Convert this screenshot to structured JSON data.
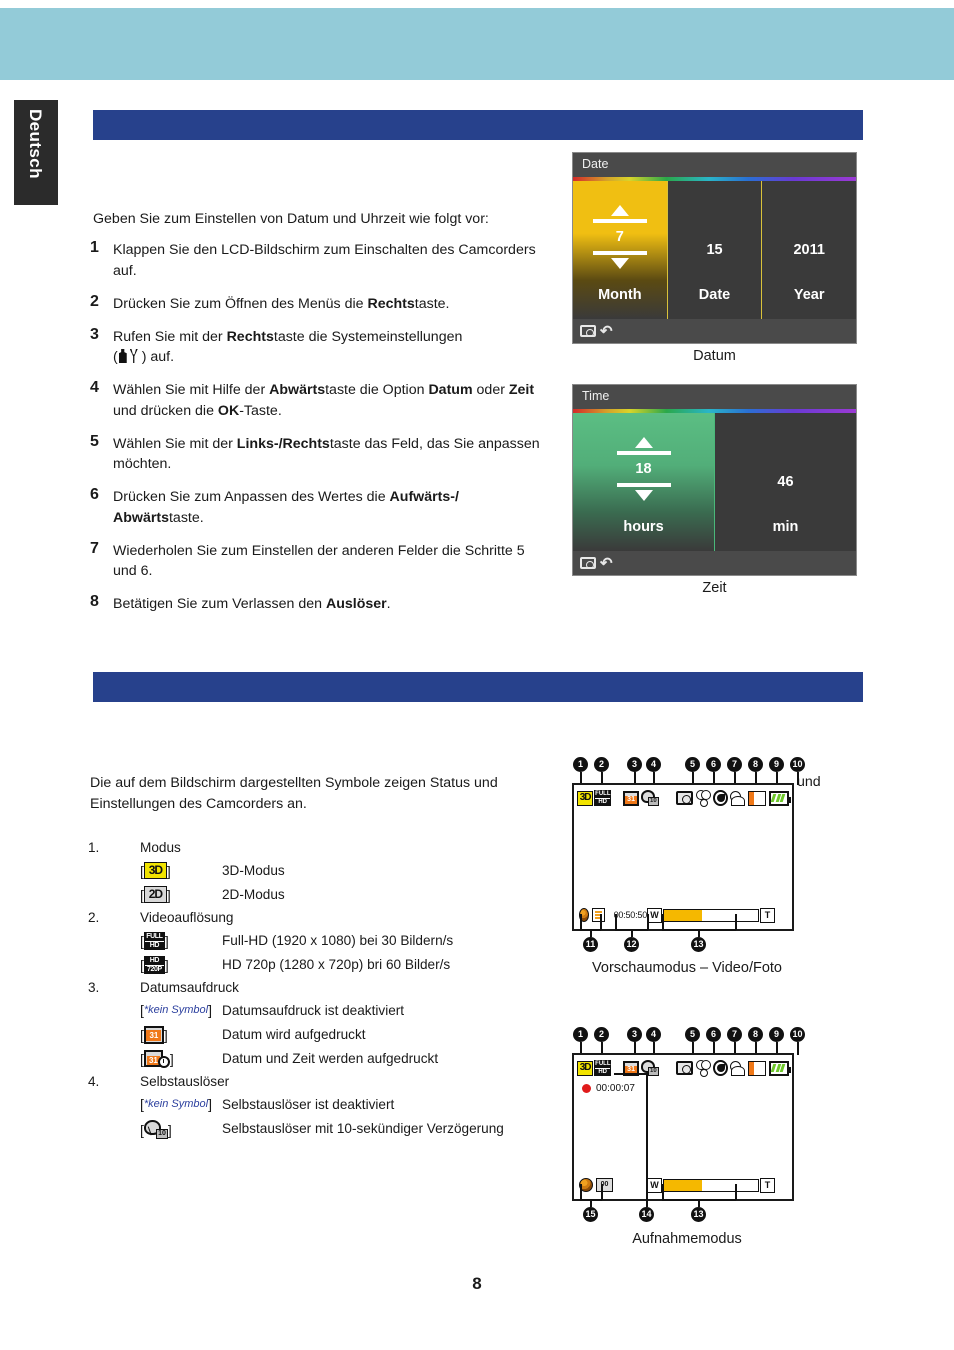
{
  "page": {
    "language_tab": "Deutsch",
    "page_number": "8",
    "band_color": "#93cbd8",
    "header_bar_color": "#27418c"
  },
  "section_datetime": {
    "intro": "Geben Sie zum Einstellen von Datum und Uhrzeit wie folgt vor:",
    "steps": [
      {
        "num": "1",
        "parts": [
          {
            "t": "Klappen Sie den LCD-Bildschirm zum Einschalten des Camcorders auf.",
            "b": false
          }
        ]
      },
      {
        "num": "2",
        "parts": [
          {
            "t": "Drücken Sie zum Öffnen des Menüs die ",
            "b": false
          },
          {
            "t": "Rechts",
            "b": true
          },
          {
            "t": "taste.",
            "b": false
          }
        ]
      },
      {
        "num": "3",
        "parts": [
          {
            "t": "Rufen Sie mit der ",
            "b": false
          },
          {
            "t": "Rechts",
            "b": true
          },
          {
            "t": "taste die Systemeinstellungen",
            "b": false
          },
          {
            "icon": "wrench-tools-icon"
          },
          {
            "t": ") auf.",
            "b": false
          }
        ]
      },
      {
        "num": "4",
        "parts": [
          {
            "t": "Wählen Sie mit Hilfe der ",
            "b": false
          },
          {
            "t": "Abwärts",
            "b": true
          },
          {
            "t": "taste die Option ",
            "b": false
          },
          {
            "t": "Datum",
            "b": true
          },
          {
            "t": " oder ",
            "b": false
          },
          {
            "t": "Zeit",
            "b": true
          },
          {
            "t": " und drücken die ",
            "b": false
          },
          {
            "t": "OK",
            "b": true
          },
          {
            "t": "-Taste.",
            "b": false
          }
        ]
      },
      {
        "num": "5",
        "parts": [
          {
            "t": "Wählen Sie mit der ",
            "b": false
          },
          {
            "t": "Links-/Rechts",
            "b": true
          },
          {
            "t": "taste das Feld, das Sie anpassen möchten.",
            "b": false
          }
        ]
      },
      {
        "num": "6",
        "parts": [
          {
            "t": "Drücken Sie zum Anpassen des Wertes die ",
            "b": false
          },
          {
            "t": "Aufwärts-/ Abwärts",
            "b": true
          },
          {
            "t": "taste.",
            "b": false
          }
        ]
      },
      {
        "num": "7",
        "parts": [
          {
            "t": "Wiederholen Sie zum Einstellen der anderen Felder die Schritte 5 und 6.",
            "b": false
          }
        ]
      },
      {
        "num": "8",
        "parts": [
          {
            "t": "Betätigen Sie zum Verlassen den ",
            "b": false
          },
          {
            "t": "Auslöser",
            "b": true
          },
          {
            "t": ".",
            "b": false
          }
        ]
      }
    ]
  },
  "date_screen": {
    "title": "Date",
    "caption": "Datum",
    "highlight_color": "#f0bf12",
    "fields": [
      {
        "value": "7",
        "label": "Month",
        "active": true
      },
      {
        "value": "15",
        "label": "Date",
        "active": false
      },
      {
        "value": "2011",
        "label": "Year",
        "active": false
      }
    ]
  },
  "time_screen": {
    "title": "Time",
    "caption": "Zeit",
    "highlight_color": "#5bbe83",
    "fields": [
      {
        "value": "18",
        "label": "hours",
        "active": true
      },
      {
        "value": "46",
        "label": "min",
        "active": false
      }
    ]
  },
  "section_icons": {
    "intro": "Die auf dem Bildschirm dargestellten Symbole zeigen Status und Einstellungen des Camcorders an.",
    "und_word": "und",
    "groups": [
      {
        "index": "1.",
        "title": "Modus",
        "rows": [
          {
            "symbol": "3d-mode-icon",
            "sym_text": "3D",
            "desc": "3D-Modus"
          },
          {
            "symbol": "2d-mode-icon",
            "sym_text": "2D",
            "desc": "2D-Modus"
          }
        ]
      },
      {
        "index": "2.",
        "title": "Videoauflösung",
        "rows": [
          {
            "symbol": "full-hd-icon",
            "sym_top": "FULL",
            "sym_bot": "HD",
            "desc": "Full-HD (1920 x 1080) bei 30 Bildern/s"
          },
          {
            "symbol": "hd-720p-icon",
            "sym_top": "HD",
            "sym_bot": "720P",
            "desc": "HD 720p (1280 x 720p) bri 60 Bilder/s"
          }
        ]
      },
      {
        "index": "3.",
        "title": "Datumsaufdruck",
        "rows": [
          {
            "symbol": "no-symbol",
            "sym_text": "*kein Symbol",
            "desc": "Datumsaufdruck ist deaktiviert"
          },
          {
            "symbol": "date-stamp-icon",
            "sym_text": "31",
            "desc": "Datum wird aufgedruckt"
          },
          {
            "symbol": "date-time-stamp-icon",
            "sym_text": "31",
            "desc": "Datum und Zeit werden aufgedruckt"
          }
        ]
      },
      {
        "index": "4.",
        "title": "Selbstauslöser",
        "rows": [
          {
            "symbol": "no-symbol",
            "sym_text": "*kein Symbol",
            "desc": "Selbstauslöser ist deaktiviert"
          },
          {
            "symbol": "self-timer-10s-icon",
            "sym_text": "10",
            "desc": "Selbstauslöser mit 10-sekündiger Verzögerung"
          }
        ]
      }
    ]
  },
  "osd_preview": {
    "caption": "Vorschaumodus – Video/Foto",
    "time_counter": "00:50:50",
    "zoom_wide_label": "W",
    "zoom_tele_label": "T",
    "zoom_fill_percent": 40,
    "mode_label": "3D",
    "res_top": "FULL",
    "res_bot": "HD",
    "date_stamp_day": "31",
    "self_timer_sec": "10",
    "callouts_top": [
      "1",
      "2",
      "3",
      "4",
      "5",
      "6",
      "7",
      "8",
      "9",
      "10"
    ],
    "callouts_bottom": [
      "11",
      "12",
      "13"
    ]
  },
  "osd_record": {
    "caption": "Aufnahmemodus",
    "rec_time": "00:00:07",
    "zoom_wide_label": "W",
    "zoom_tele_label": "T",
    "zoom_fill_percent": 40,
    "mode_label": "3D",
    "res_top": "FULL",
    "res_bot": "HD",
    "date_stamp_day": "31",
    "self_timer_sec": "10",
    "counter_label": "00",
    "callouts_top": [
      "1",
      "2",
      "3",
      "4",
      "5",
      "6",
      "7",
      "8",
      "9",
      "10"
    ],
    "callouts_bottom": [
      "15",
      "14",
      "13"
    ]
  }
}
